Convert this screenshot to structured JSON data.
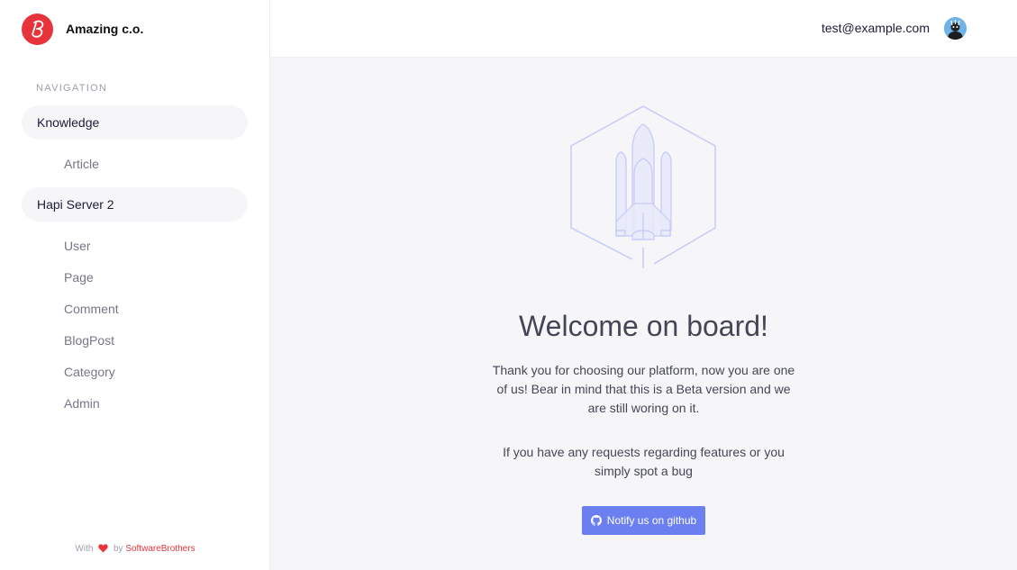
{
  "brand": {
    "name": "Amazing c.o.",
    "logo_icon": "brand-b-logo",
    "color": "#e7343a"
  },
  "navigation": {
    "heading": "NAVIGATION",
    "groups": [
      {
        "label": "Knowledge",
        "items": [
          {
            "label": "Article"
          }
        ]
      },
      {
        "label": "Hapi Server 2",
        "items": [
          {
            "label": "User"
          },
          {
            "label": "Page"
          },
          {
            "label": "Comment"
          },
          {
            "label": "BlogPost"
          },
          {
            "label": "Category"
          },
          {
            "label": "Admin"
          }
        ]
      }
    ]
  },
  "footer": {
    "prefix": "With",
    "by": "by",
    "link_text": "SoftwareBrothers",
    "heart_icon": "heart-icon"
  },
  "header": {
    "user_email": "test@example.com",
    "avatar_icon": "user-avatar"
  },
  "dashboard": {
    "illustration_icon": "rocket-hexagon-icon",
    "title": "Welcome on board!",
    "paragraph_1": "Thank you for choosing our platform, now you are one of us! Bear in mind that this is a Beta version and we are still woring on it.",
    "paragraph_2": "If you have any requests regarding features or you simply spot a bug",
    "button_label": "Notify us on github",
    "button_icon": "github-icon"
  },
  "colors": {
    "accent": "#6c7ff0",
    "brand": "#e7343a",
    "background": "#f6f6f9"
  }
}
